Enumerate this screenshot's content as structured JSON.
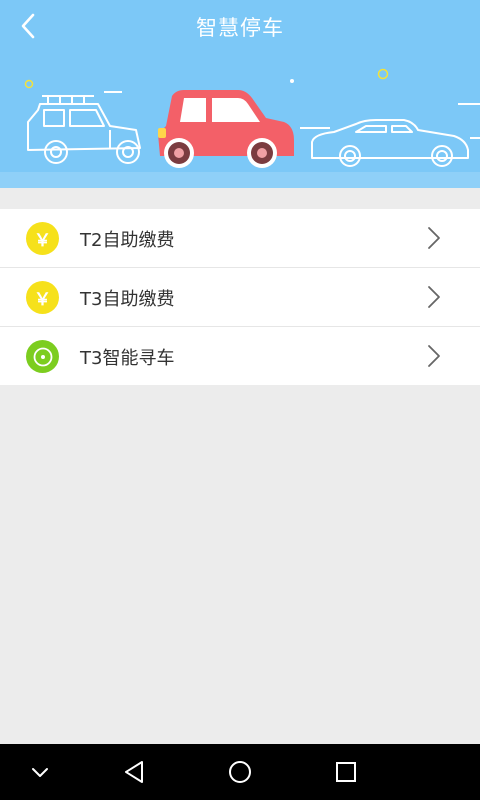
{
  "header": {
    "title": "智慧停车",
    "back_icon": "chevron-left-icon",
    "background_color": "#7cc8f7"
  },
  "menu": {
    "items": [
      {
        "label": "T2自助缴费",
        "icon": "yuan-icon",
        "icon_color": "#f6e11b"
      },
      {
        "label": "T3自助缴费",
        "icon": "yuan-icon",
        "icon_color": "#f6e11b"
      },
      {
        "label": "T3智能寻车",
        "icon": "target-icon",
        "icon_color": "#7ccd1f"
      }
    ]
  },
  "icons": {
    "yuan_glyph": "￥"
  },
  "navbar": {
    "buttons": [
      "collapse-down-icon",
      "back-triangle-icon",
      "home-circle-icon",
      "recents-square-icon"
    ]
  }
}
